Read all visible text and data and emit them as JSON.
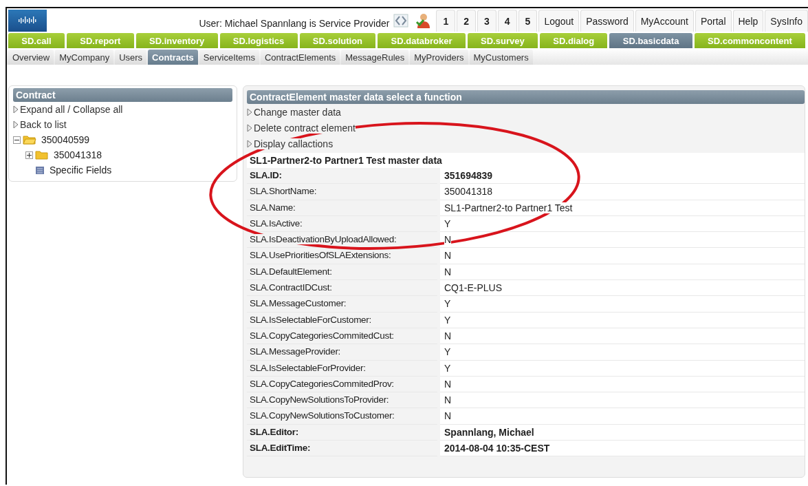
{
  "header": {
    "user_text": "User: Michael Spannlang is Service Provider",
    "pages": [
      {
        "label": "1",
        "selected": false
      },
      {
        "label": "2",
        "selected": false
      },
      {
        "label": "3",
        "selected": false
      },
      {
        "label": "4",
        "selected": false
      },
      {
        "label": "5",
        "selected": false
      }
    ],
    "links": [
      "Logout",
      "Password",
      "MyAccount",
      "Portal",
      "Help",
      "SysInfo"
    ]
  },
  "modules": [
    {
      "label": "SD.call",
      "selected": false
    },
    {
      "label": "SD.report",
      "selected": false
    },
    {
      "label": "SD.inventory",
      "selected": false
    },
    {
      "label": "SD.logistics",
      "selected": false
    },
    {
      "label": "SD.solution",
      "selected": false
    },
    {
      "label": "SD.databroker",
      "selected": false
    },
    {
      "label": "SD.survey",
      "selected": false
    },
    {
      "label": "SD.dialog",
      "selected": false
    },
    {
      "label": "SD.basicdata",
      "selected": true
    },
    {
      "label": "SD.commoncontent",
      "selected": false
    }
  ],
  "subtabs": [
    {
      "label": "Overview",
      "selected": false
    },
    {
      "label": "MyCompany",
      "selected": false
    },
    {
      "label": "Users",
      "selected": false
    },
    {
      "label": "Contracts",
      "selected": true
    },
    {
      "label": "ServiceItems",
      "selected": false
    },
    {
      "label": "ContractElements",
      "selected": false
    },
    {
      "label": "MessageRules",
      "selected": false
    },
    {
      "label": "MyProviders",
      "selected": false
    },
    {
      "label": "MyCustomers",
      "selected": false
    }
  ],
  "sidebar": {
    "title": "Contract",
    "actions": [
      "Expand all / Collapse all",
      "Back to list"
    ],
    "tree": [
      {
        "label": "350040599",
        "kind": "folder",
        "expanded": true,
        "children": [
          {
            "label": "350041318",
            "kind": "folder",
            "expanded": false
          },
          {
            "label": "Specific Fields",
            "kind": "fields"
          }
        ]
      }
    ]
  },
  "main": {
    "title": "ContractElement master data select a function",
    "functions": [
      "Change master data",
      "Delete contract element",
      "Display callactions"
    ],
    "section_title": "SL1-Partner2-to Partner1 Test master data",
    "rows": [
      {
        "label": "SLA.ID:",
        "value": "351694839",
        "bold": true
      },
      {
        "label": "SLA.ShortName:",
        "value": "350041318",
        "bold": false
      },
      {
        "label": "SLA.Name:",
        "value": "SL1-Partner2-to Partner1 Test",
        "bold": false
      },
      {
        "label": "SLA.IsActive:",
        "value": "Y",
        "bold": false
      },
      {
        "label": "SLA.IsDeactivationByUploadAllowed:",
        "value": "N",
        "bold": false
      },
      {
        "label": "SLA.UsePrioritiesOfSLAExtensions:",
        "value": "N",
        "bold": false
      },
      {
        "label": "SLA.DefaultElement:",
        "value": "N",
        "bold": false
      },
      {
        "label": "SLA.ContractIDCust:",
        "value": "CQ1-E-PLUS",
        "bold": false
      },
      {
        "label": "SLA.MessageCustomer:",
        "value": "Y",
        "bold": false
      },
      {
        "label": "SLA.IsSelectableForCustomer:",
        "value": "Y",
        "bold": false
      },
      {
        "label": "SLA.CopyCategoriesCommitedCust:",
        "value": "N",
        "bold": false
      },
      {
        "label": "SLA.MessageProvider:",
        "value": "Y",
        "bold": false
      },
      {
        "label": "SLA.IsSelectableForProvider:",
        "value": "Y",
        "bold": false
      },
      {
        "label": "SLA.CopyCategoriesCommitedProv:",
        "value": "N",
        "bold": false
      },
      {
        "label": "SLA.CopyNewSolutionsToProvider:",
        "value": "N",
        "bold": false
      },
      {
        "label": "SLA.CopyNewSolutionsToCustomer:",
        "value": "N",
        "bold": false
      },
      {
        "label": "SLA.Editor:",
        "value": "Spannlang, Michael",
        "bold": true
      },
      {
        "label": "SLA.EditTime:",
        "value": "2014-08-04 10:35-CEST",
        "bold": true
      }
    ]
  }
}
